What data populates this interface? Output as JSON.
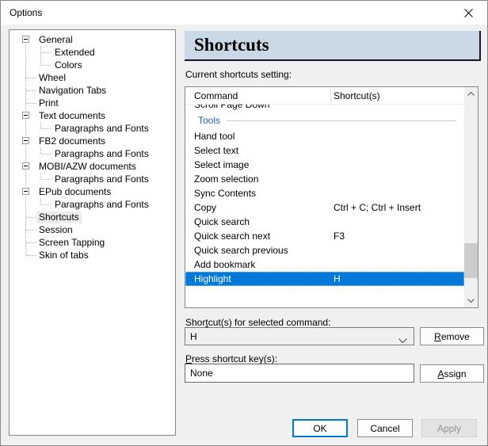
{
  "window": {
    "title": "Options"
  },
  "tree": {
    "items": [
      {
        "label": "General",
        "level": 0,
        "expandable": true
      },
      {
        "label": "Extended",
        "level": 1,
        "last": false
      },
      {
        "label": "Colors",
        "level": 1,
        "last": true
      },
      {
        "label": "Wheel",
        "level": 0
      },
      {
        "label": "Navigation Tabs",
        "level": 0
      },
      {
        "label": "Print",
        "level": 0
      },
      {
        "label": "Text documents",
        "level": 0,
        "expandable": true
      },
      {
        "label": "Paragraphs and Fonts",
        "level": 1,
        "last": true
      },
      {
        "label": "FB2 documents",
        "level": 0,
        "expandable": true
      },
      {
        "label": "Paragraphs and Fonts",
        "level": 1,
        "last": true
      },
      {
        "label": "MOBI/AZW documents",
        "level": 0,
        "expandable": true
      },
      {
        "label": "Paragraphs and Fonts",
        "level": 1,
        "last": true
      },
      {
        "label": "EPub documents",
        "level": 0,
        "expandable": true
      },
      {
        "label": "Paragraphs and Fonts",
        "level": 1,
        "last": true
      },
      {
        "label": "Shortcuts",
        "level": 0,
        "selected": true
      },
      {
        "label": "Session",
        "level": 0
      },
      {
        "label": "Screen Tapping",
        "level": 0
      },
      {
        "label": "Skin of tabs",
        "level": 0
      }
    ]
  },
  "panel": {
    "header": "Shortcuts",
    "list_label": "Current shortcuts setting:",
    "columns": {
      "command": "Command",
      "shortcut": "Shortcut(s)"
    },
    "clipped_row": "Scroll Page Down",
    "group_label": "Tools",
    "rows": [
      {
        "command": "Hand tool",
        "shortcut": ""
      },
      {
        "command": "Select text",
        "shortcut": ""
      },
      {
        "command": "Select image",
        "shortcut": ""
      },
      {
        "command": "Zoom selection",
        "shortcut": ""
      },
      {
        "command": "Sync Contents",
        "shortcut": ""
      },
      {
        "command": "Copy",
        "shortcut": "Ctrl + C; Ctrl + Insert"
      },
      {
        "command": "Quick search",
        "shortcut": ""
      },
      {
        "command": "Quick search next",
        "shortcut": "F3"
      },
      {
        "command": "Quick search previous",
        "shortcut": ""
      },
      {
        "command": "Add bookmark",
        "shortcut": ""
      },
      {
        "command": "Highlight",
        "shortcut": "H",
        "selected": true
      }
    ],
    "selected_shortcut_label": {
      "text": "Shortcut(s) for selected command:",
      "m": 4
    },
    "combobox_value": "H",
    "remove_button": {
      "text": "Remove",
      "m": 0
    },
    "press_label": {
      "text": "Press shortcut key(s):",
      "m": 0
    },
    "press_value": "None",
    "assign_button": {
      "text": "Assign",
      "m": 0
    }
  },
  "footer": {
    "ok": "OK",
    "cancel": "Cancel",
    "apply": "Apply"
  },
  "colors": {
    "accent": "#0078d7",
    "selection_bg": "#0078d7",
    "banner_bg": "#cbd8e6",
    "group_text": "#2b5fa6",
    "dialog_bg": "#f0f0f0"
  }
}
